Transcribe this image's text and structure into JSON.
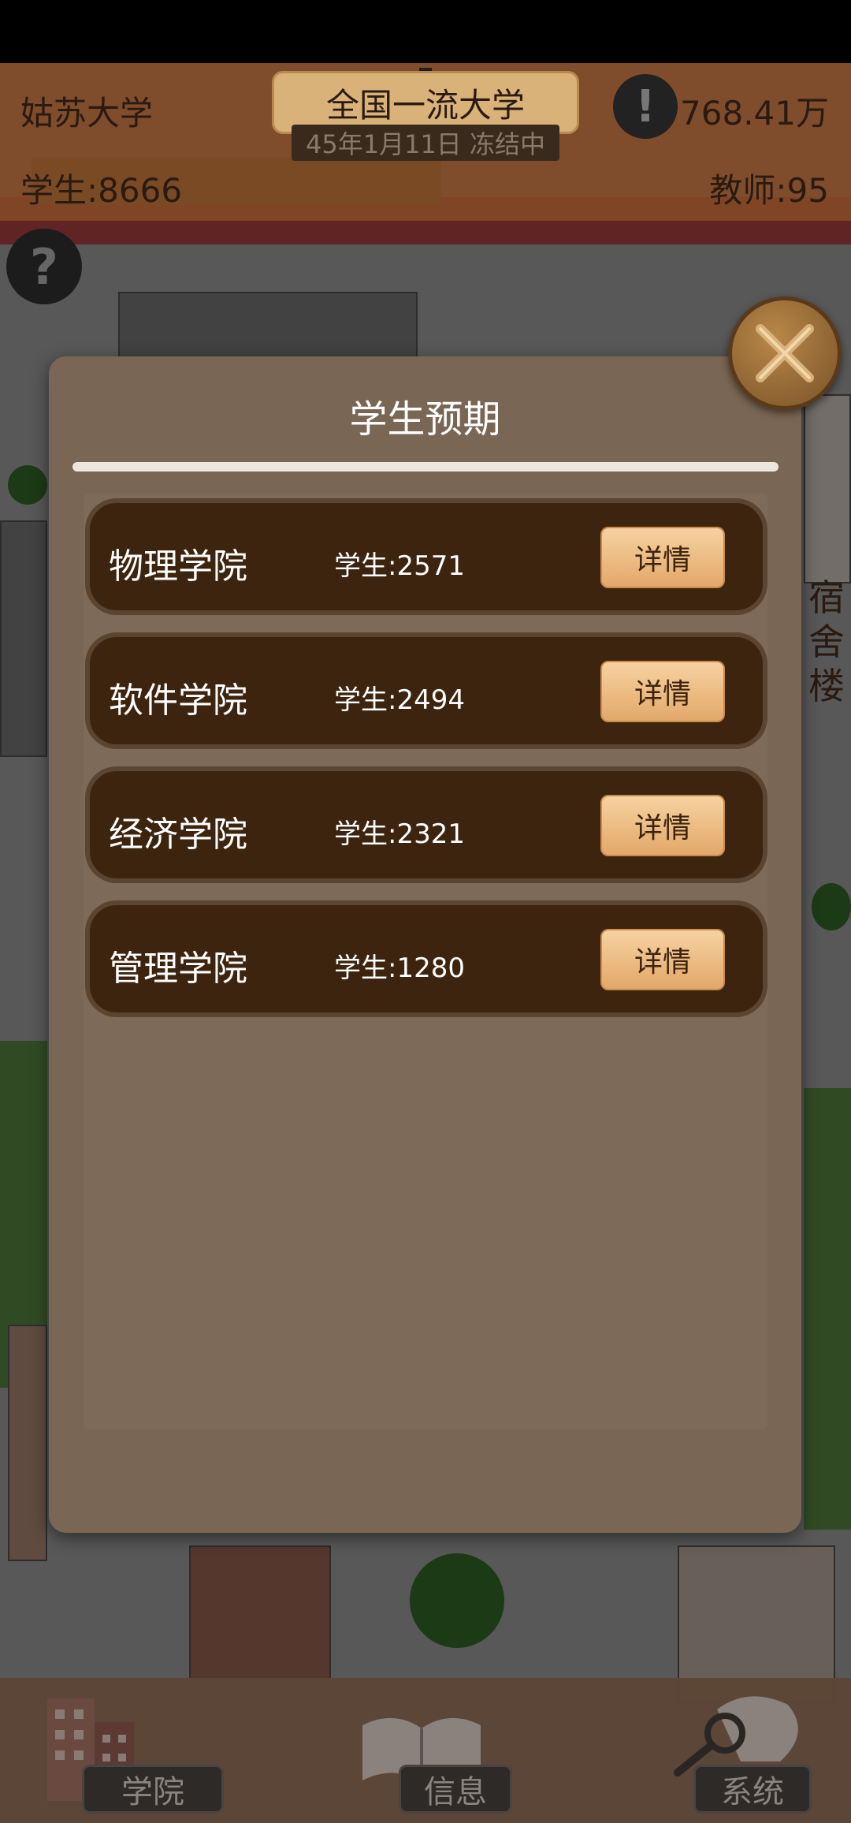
{
  "hud": {
    "school_name": "姑苏大学",
    "money": "768.41万",
    "students": "学生:8666",
    "teachers": "教师:95",
    "rank": "全国一流大学",
    "date_status": "45年1月11日 冻结中"
  },
  "background": {
    "dorm_label": "宿舍楼"
  },
  "modal": {
    "title": "学生预期",
    "rows": [
      {
        "name": "物理学院",
        "count": "学生:2571",
        "button": "详情"
      },
      {
        "name": "软件学院",
        "count": "学生:2494",
        "button": "详情"
      },
      {
        "name": "经济学院",
        "count": "学生:2321",
        "button": "详情"
      },
      {
        "name": "管理学院",
        "count": "学生:1280",
        "button": "详情"
      }
    ]
  },
  "bottom_nav": {
    "items": [
      {
        "label": "学院",
        "icon": "building-icon"
      },
      {
        "label": "信息",
        "icon": "book-icon"
      },
      {
        "label": "系统",
        "icon": "settings-icon"
      }
    ]
  },
  "icons": {
    "alert": "!",
    "help": "?"
  },
  "colors": {
    "modal_bg": "#7a6654",
    "row_bg": "#3c240e",
    "button_bg": "#e8b47a",
    "close_button": "#9a6a36"
  }
}
